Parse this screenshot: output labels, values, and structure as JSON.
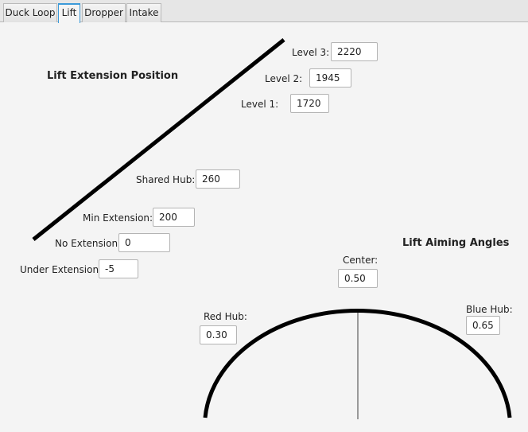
{
  "tabs": [
    {
      "label": "Duck Loop",
      "active": false
    },
    {
      "label": "Lift",
      "active": true
    },
    {
      "label": "Dropper",
      "active": false
    },
    {
      "label": "Intake",
      "active": false
    }
  ],
  "lift": {
    "title": "Lift Extension Position",
    "level3": {
      "label": "Level 3:",
      "value": "2220"
    },
    "level2": {
      "label": "Level 2:",
      "value": "1945"
    },
    "level1": {
      "label": "Level 1:",
      "value": "1720"
    },
    "shared_hub": {
      "label": "Shared Hub:",
      "value": "260"
    },
    "min_extension": {
      "label": "Min Extension:",
      "value": "200"
    },
    "no_extension": {
      "label": "No Extension:",
      "value": "0"
    },
    "under_extension": {
      "label": "Under Extension:",
      "value": "-5"
    }
  },
  "aiming": {
    "title": "Lift Aiming Angles",
    "center": {
      "label": "Center:",
      "value": "0.50"
    },
    "red_hub": {
      "label": "Red Hub:",
      "value": "0.30"
    },
    "blue_hub": {
      "label": "Blue Hub:",
      "value": "0.65"
    }
  },
  "colors": {
    "active_tab_accent": "#3b9ad9",
    "line": "#000000",
    "center_marker": "#999999"
  }
}
